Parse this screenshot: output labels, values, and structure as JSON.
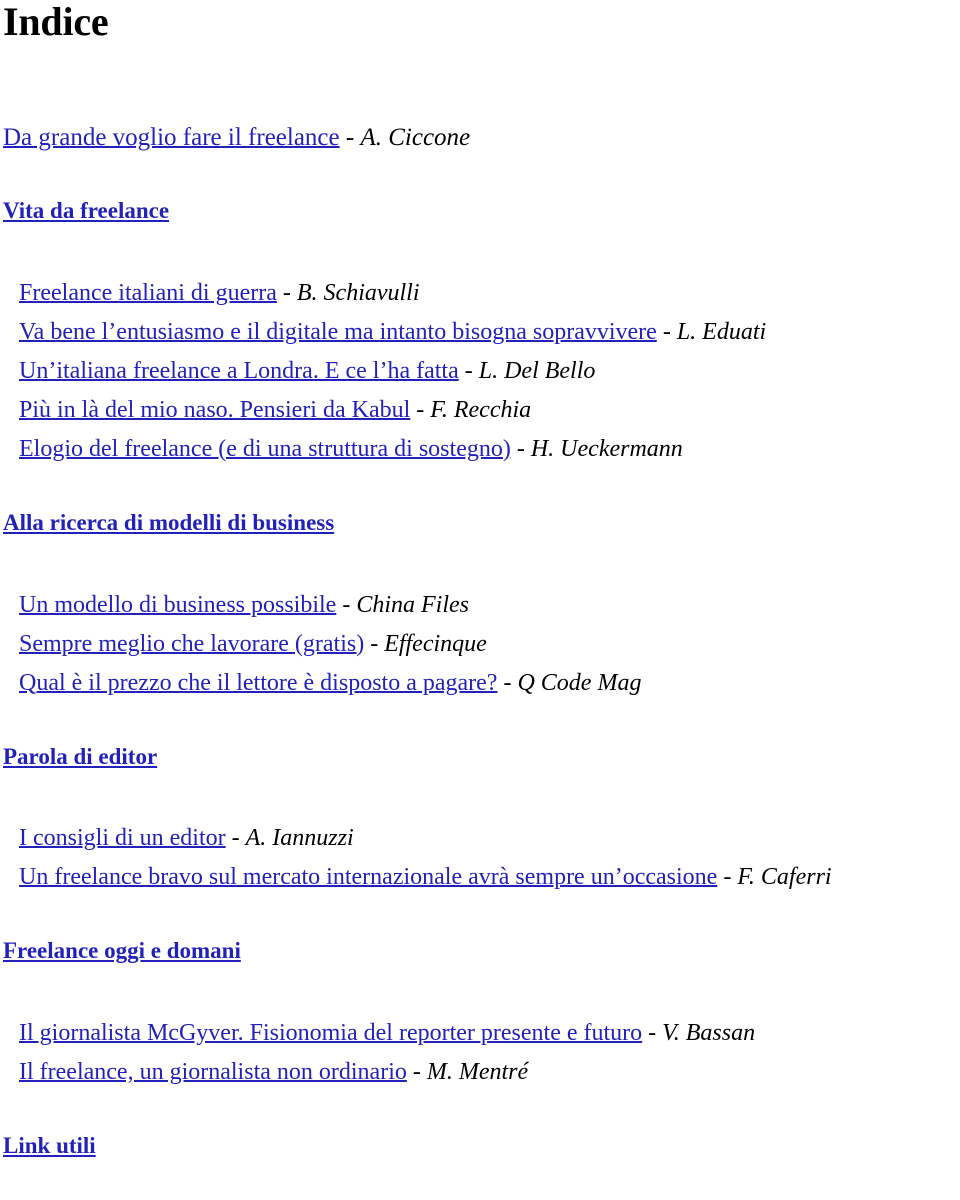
{
  "document": {
    "title": "Indice"
  },
  "lead_entry": {
    "link": "Da grande voglio fare il freelance",
    "separator": "-",
    "author": "A. Ciccone"
  },
  "sections": [
    {
      "heading": "Vita da freelance",
      "entries": [
        {
          "link": "Freelance italiani di guerra",
          "separator": "-",
          "author": "B. Schiavulli"
        },
        {
          "link": "Va bene l’entusiasmo e il digitale ma intanto bisogna sopravvivere",
          "separator": "-",
          "author": "L. Eduati"
        },
        {
          "link": "Un’italiana freelance a Londra. E ce l’ha fatta",
          "separator": "-",
          "author": "L. Del Bello"
        },
        {
          "link": "Più in là del mio naso. Pensieri da Kabul",
          "separator": "-",
          "author": "F. Recchia"
        },
        {
          "link": "Elogio del freelance (e di una struttura di sostegno)",
          "separator": "-",
          "author": "H. Ueckermann"
        }
      ]
    },
    {
      "heading": "Alla ricerca di modelli di business",
      "entries": [
        {
          "link": "Un modello di business possibile",
          "separator": "-",
          "author": "China Files"
        },
        {
          "link": "Sempre meglio che lavorare (gratis)",
          "separator": "-",
          "author": "Effecinque"
        },
        {
          "link": "Qual è il prezzo che il lettore è disposto a pagare?",
          "separator": "-",
          "author": "Q Code Mag"
        }
      ]
    },
    {
      "heading": "Parola di editor",
      "entries": [
        {
          "link": "I consigli di un editor",
          "separator": "-",
          "author": "A. Iannuzzi"
        },
        {
          "link": "Un freelance bravo sul mercato internazionale avrà sempre un’occasione",
          "separator": "-",
          "author": "F. Caferri"
        }
      ]
    },
    {
      "heading": "Freelance oggi e domani",
      "entries": [
        {
          "link": "Il giornalista McGyver. Fisionomia del reporter presente e futuro",
          "separator": "-",
          "author": "V. Bassan"
        },
        {
          "link": "Il freelance, un giornalista non ordinario",
          "separator": "-",
          "author": "M. Mentré"
        }
      ]
    },
    {
      "heading": "Link utili",
      "entries": []
    }
  ],
  "colors": {
    "link": "#2222bb",
    "text": "#000000",
    "background": "#ffffff"
  }
}
